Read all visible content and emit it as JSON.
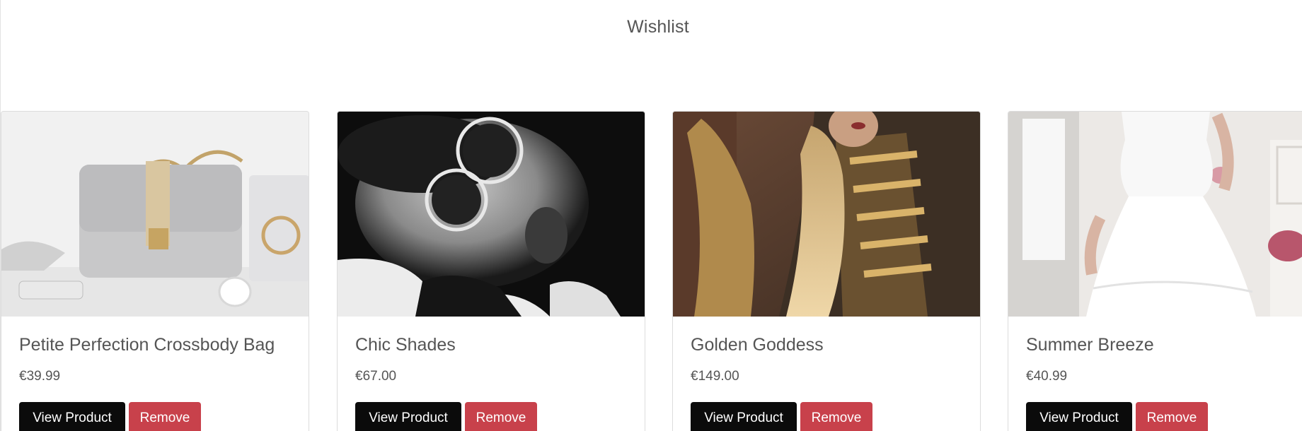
{
  "page": {
    "title": "Wishlist"
  },
  "buttons": {
    "view_label": "View Product",
    "remove_label": "Remove"
  },
  "products": [
    {
      "name": "Chic Shades",
      "price": "€67.00",
      "image": "sunglasses-portrait-image"
    },
    {
      "name": "Golden Goddess",
      "price": "€149.00",
      "image": "gold-sequin-top-image"
    },
    {
      "name": "Summer Breeze",
      "price": "€40.99",
      "image": "white-dress-image"
    },
    {
      "name": "Petite Perfection Crossbody Bag",
      "price": "€39.99",
      "image": "grey-crossbody-bag-image"
    }
  ],
  "colors": {
    "view_button": "#0b0b0b",
    "remove_button": "#c8414b",
    "text": "#555555",
    "card_border": "#dcdcdc"
  }
}
